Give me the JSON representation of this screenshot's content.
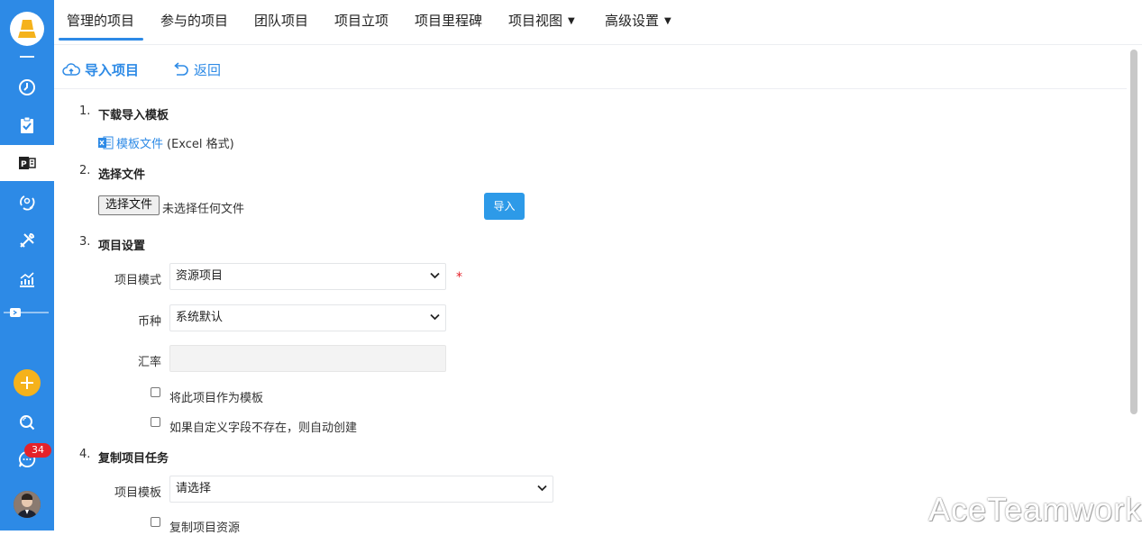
{
  "sidebar": {
    "logo": "logo-icon",
    "items": [
      {
        "icon": "clock-icon"
      },
      {
        "icon": "clipboard-check-icon"
      },
      {
        "icon": "project-icon",
        "active": true
      },
      {
        "icon": "team-cycle-icon"
      },
      {
        "icon": "tools-icon"
      },
      {
        "icon": "chart-icon"
      }
    ],
    "message_badge": "34"
  },
  "nav": {
    "tabs": [
      {
        "label": "管理的项目",
        "active": true
      },
      {
        "label": "参与的项目"
      },
      {
        "label": "团队项目"
      },
      {
        "label": "项目立项"
      },
      {
        "label": "项目里程碑"
      },
      {
        "label": "项目视图",
        "dropdown": true
      },
      {
        "label": "高级设置",
        "dropdown": true
      }
    ]
  },
  "toolbar": {
    "import_label": "导入项目",
    "back_label": "返回"
  },
  "form": {
    "step1": {
      "num": "1.",
      "title": "下载导入模板",
      "link": "模板文件",
      "note": "(Excel 格式)"
    },
    "step2": {
      "num": "2.",
      "title": "选择文件",
      "choose_btn": "选择文件",
      "file_status": "未选择任何文件",
      "import_btn": "导入"
    },
    "step3": {
      "num": "3.",
      "title": "项目设置",
      "mode_label": "项目模式",
      "mode_value": "资源项目",
      "required_mark": "*",
      "currency_label": "币种",
      "currency_value": "系统默认",
      "rate_label": "汇率",
      "cb_template": "将此项目作为模板",
      "cb_custom": "如果自定义字段不存在，则自动创建"
    },
    "step4": {
      "num": "4.",
      "title": "复制项目任务",
      "template_label": "项目模板",
      "template_value": "请选择",
      "cb_resource": "复制项目资源"
    }
  },
  "watermark": "AceTeamwork",
  "colors": {
    "accent": "#2d8ae6",
    "badge": "#e5222a",
    "add": "#f5b21b"
  }
}
